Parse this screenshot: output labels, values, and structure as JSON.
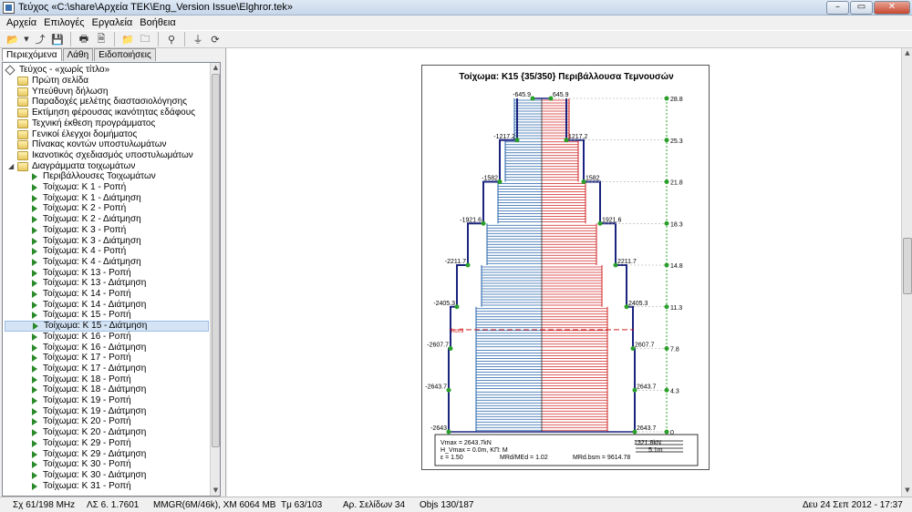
{
  "window": {
    "title": "Τεύχος «C:\\share\\Αρχεία ΤΕΚ\\Eng_Version Issue\\Elghror.tek»"
  },
  "menu": [
    "Αρχεία",
    "Επιλογές",
    "Εργαλεία",
    "Βοήθεια"
  ],
  "tabs": [
    "Περιεχόμενα",
    "Λάθη",
    "Ειδοποιήσεις"
  ],
  "tree": {
    "root": "Τεύχος - «χωρίς τίτλο»",
    "folders": [
      "Πρώτη σελίδα",
      "Υπεύθυνη δήλωση",
      "Παραδοχές μελέτης διαστασιολόγησης",
      "Εκτίμηση φέρουσας ικανότητας εδάφους",
      "Τεχνική έκθεση προγράμματος",
      "Γενικοί έλεγχοι δομήματος",
      "Πίνακας κοντών υποστυλωμάτων",
      "Ικανοτικός σχεδιασμός υποστυλωμάτων",
      "Διαγράμματα τοιχωμάτων"
    ],
    "items": [
      "Περιβάλλουσες Τοιχωμάτων",
      "Τοίχωμα: Κ 1 - Ροπή",
      "Τοίχωμα: Κ 1 - Διάτμηση",
      "Τοίχωμα: Κ 2 - Ροπή",
      "Τοίχωμα: Κ 2 - Διάτμηση",
      "Τοίχωμα: Κ 3 - Ροπή",
      "Τοίχωμα: Κ 3 - Διάτμηση",
      "Τοίχωμα: Κ 4 - Ροπή",
      "Τοίχωμα: Κ 4 - Διάτμηση",
      "Τοίχωμα: Κ 13 - Ροπή",
      "Τοίχωμα: Κ 13 - Διάτμηση",
      "Τοίχωμα: Κ 14 - Ροπή",
      "Τοίχωμα: Κ 14 - Διάτμηση",
      "Τοίχωμα: Κ 15 - Ροπή",
      "Τοίχωμα: Κ 15 - Διάτμηση",
      "Τοίχωμα: Κ 16 - Ροπή",
      "Τοίχωμα: Κ 16 - Διάτμηση",
      "Τοίχωμα: Κ 17 - Ροπή",
      "Τοίχωμα: Κ 17 - Διάτμηση",
      "Τοίχωμα: Κ 18 - Ροπή",
      "Τοίχωμα: Κ 18 - Διάτμηση",
      "Τοίχωμα: Κ 19 - Ροπή",
      "Τοίχωμα: Κ 19 - Διάτμηση",
      "Τοίχωμα: Κ 20 - Ροπή",
      "Τοίχωμα: Κ 20 - Διάτμηση",
      "Τοίχωμα: Κ 29 - Ροπή",
      "Τοίχωμα: Κ 29 - Διάτμηση",
      "Τοίχωμα: Κ 30 - Ροπή",
      "Τοίχωμα: Κ 30 - Διάτμηση",
      "Τοίχωμα: Κ 31 - Ροπή"
    ],
    "selected_index": 14
  },
  "document": {
    "title": "Τοίχωμα: Κ15 {35/350} Περιβάλλουσα Τεμνουσών",
    "levels": [
      "28.8",
      "25.3",
      "21.8",
      "18.3",
      "14.8",
      "11.3",
      "7.8",
      "4.3",
      "0"
    ],
    "left_values": [
      "-645.9",
      "-1217.2",
      "-1582",
      "-1921.6",
      "-2211.7",
      "-2405.3",
      "-2607.7",
      "-2643.7",
      "-2643"
    ],
    "right_values": [
      "645.9",
      "1217.2",
      "1582",
      "1921.6",
      "2211.7",
      "2405.3",
      "2607.7",
      "2643.7",
      "2643.7"
    ],
    "marker_label": "hcr/3",
    "footer": {
      "vmax": "Vmax = 2643.7kN",
      "hvmax": "H_Vmax = 0.0m, ΚΠ: M",
      "eps": "ε = 1.50",
      "ratio": "MRd/MEd = 1.02",
      "right1": "1321.8kN",
      "right2": "5.1m",
      "mrd": "MRd.bsm = 9614.78"
    }
  },
  "status": {
    "cpu": "Σχ 61/198 MHz",
    "version": "ΛΣ 6. 1.7601",
    "memory": "MMGR(6M/46k), XM 6064 MB",
    "tm": "Tμ 63/103",
    "pages": "Αρ. Σελίδων 34",
    "objs": "Objs 130/187",
    "datetime": "Δευ 24 Σεπ 2012 - 17:37"
  },
  "colors": {
    "shear_left": "#1f5fa8",
    "shear_right": "#d02020",
    "envelope": "#1a237e",
    "node": "#2aa02a"
  }
}
